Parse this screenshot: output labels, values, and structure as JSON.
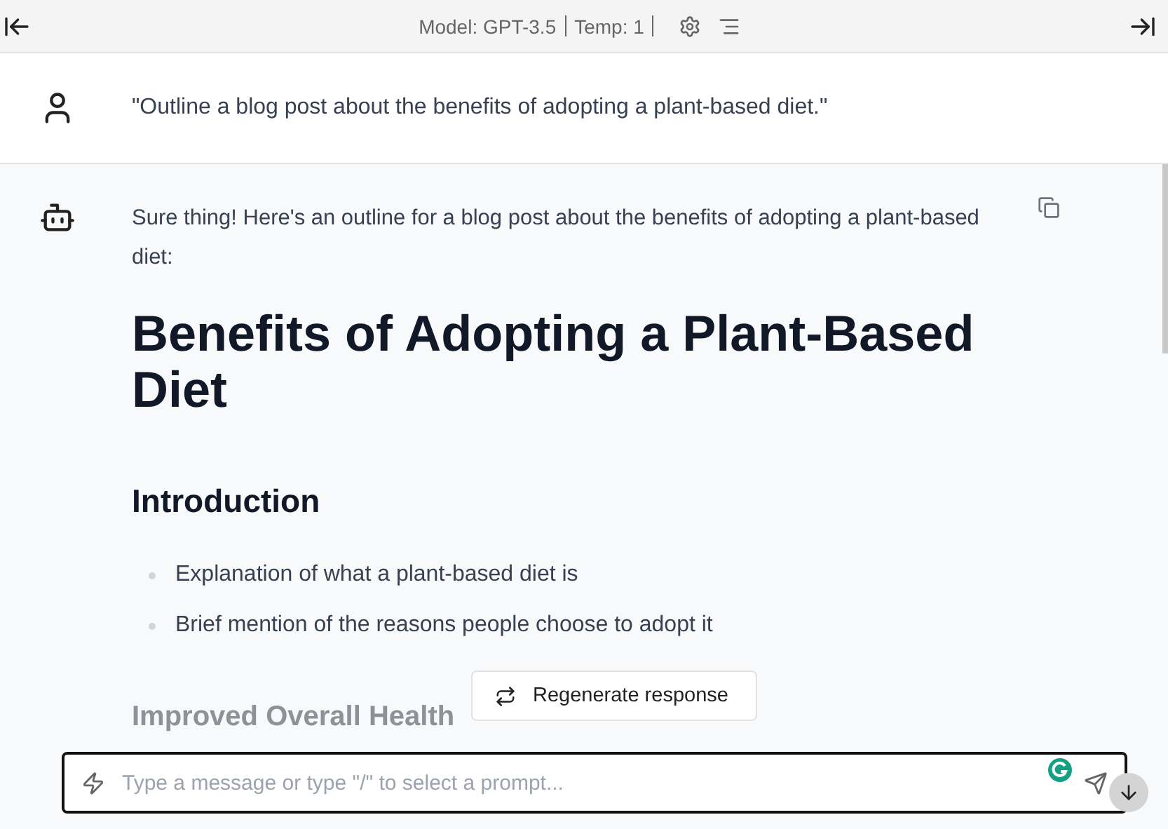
{
  "header": {
    "model": "Model: GPT-3.5",
    "temperature": "Temp: 1"
  },
  "user_message": {
    "text": "\"Outline a blog post about the benefits of adopting a plant-based diet.\""
  },
  "assistant_message": {
    "intro": "Sure thing! Here's an outline for a blog post about the benefits of adopting a plant-based diet:",
    "title": "Benefits of Adopting a Plant-Based Diet",
    "sections": [
      {
        "heading": "Introduction",
        "bullets": [
          "Explanation of what a plant-based diet is",
          "Brief mention of the reasons people choose to adopt it"
        ]
      },
      {
        "heading": "Improved Overall Health"
      }
    ]
  },
  "regenerate_button": {
    "label": "Regenerate response"
  },
  "composer": {
    "placeholder": "Type a message or type \"/\" to select a prompt..."
  }
}
